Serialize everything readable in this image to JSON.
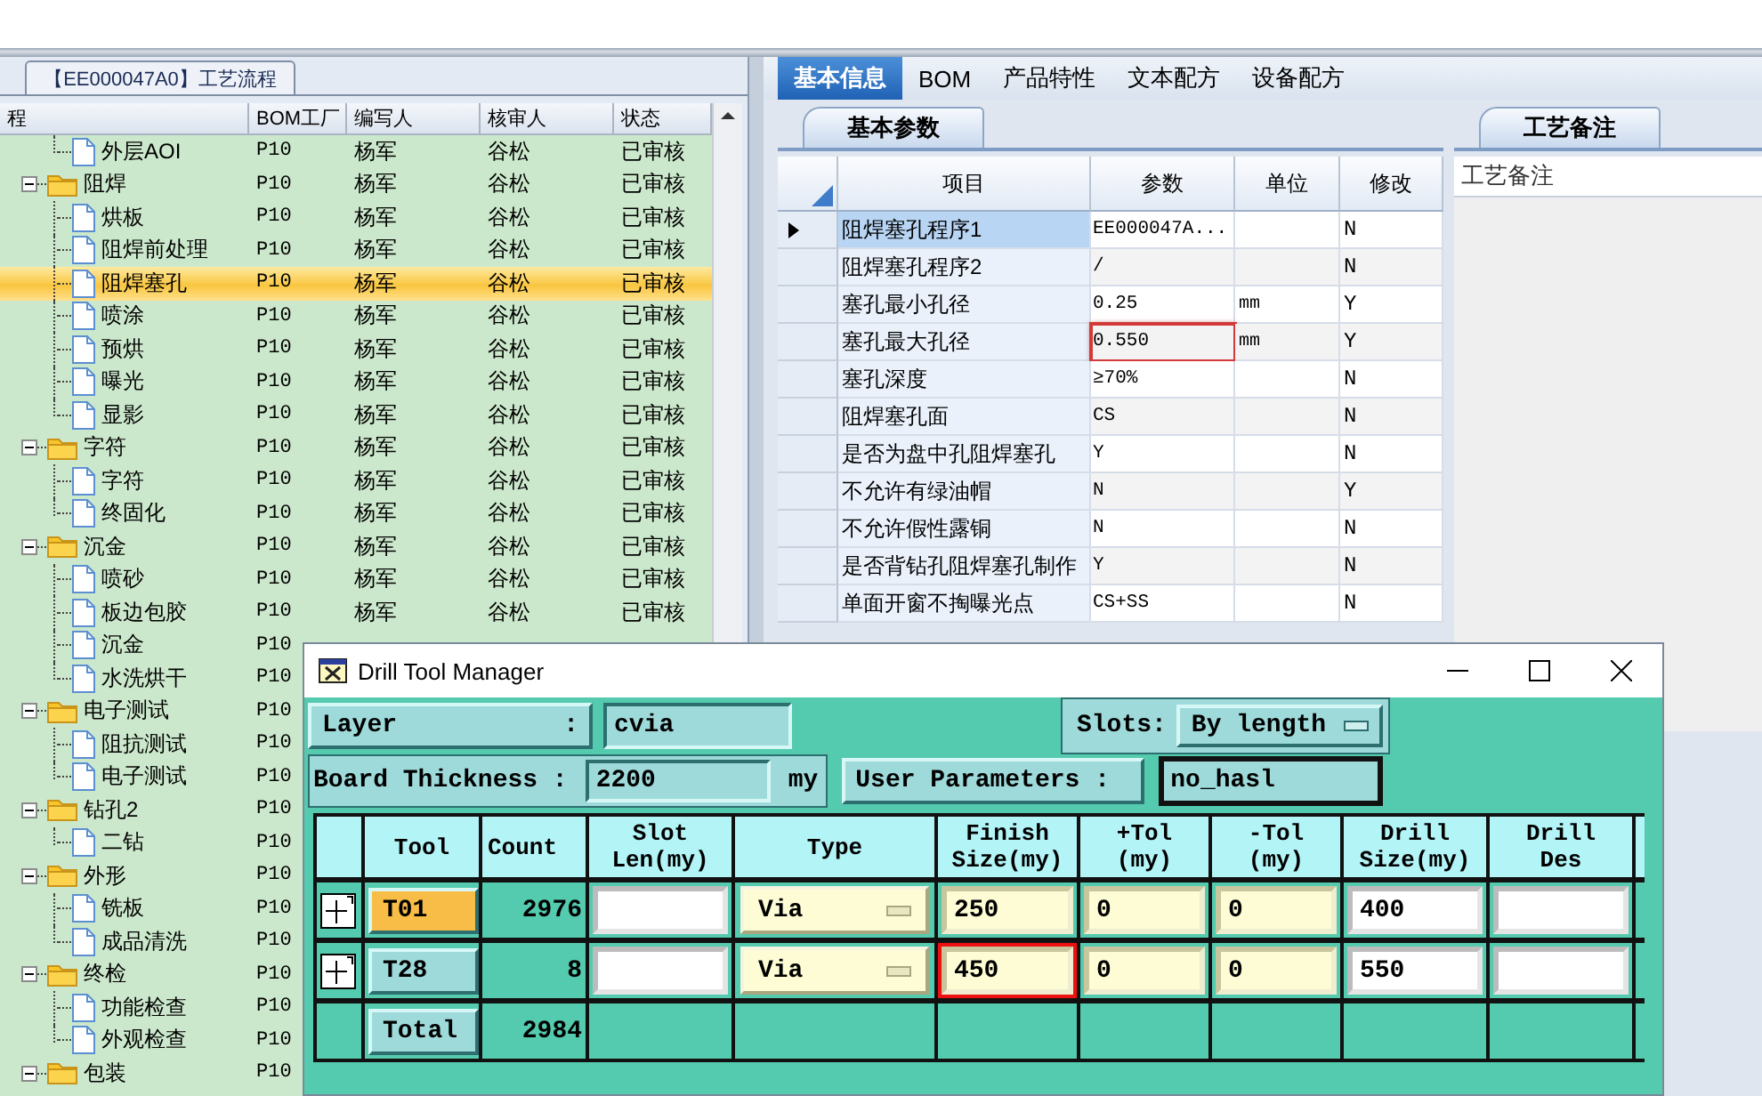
{
  "top_tab": {
    "label": "【EE000047A0】工艺流程"
  },
  "tree": {
    "columns": [
      "程",
      "BOM工厂",
      "编写人",
      "核审人",
      "状态"
    ],
    "items": [
      {
        "children": [
          {
            "name": "外层AOI",
            "bom": "P10",
            "writer": "杨军",
            "reviewer": "谷松",
            "status": "已审核",
            "selected": false
          }
        ]
      },
      {
        "name": "阻焊",
        "bom": "P10",
        "writer": "杨军",
        "reviewer": "谷松",
        "status": "已审核",
        "selected": false,
        "expanded": true,
        "children": [
          {
            "name": "烘板",
            "bom": "P10",
            "writer": "杨军",
            "reviewer": "谷松",
            "status": "已审核",
            "selected": false
          },
          {
            "name": "阻焊前处理",
            "bom": "P10",
            "writer": "杨军",
            "reviewer": "谷松",
            "status": "已审核",
            "selected": false
          },
          {
            "name": "阻焊塞孔",
            "bom": "P10",
            "writer": "杨军",
            "reviewer": "谷松",
            "status": "已审核",
            "selected": true
          },
          {
            "name": "喷涂",
            "bom": "P10",
            "writer": "杨军",
            "reviewer": "谷松",
            "status": "已审核",
            "selected": false
          },
          {
            "name": "预烘",
            "bom": "P10",
            "writer": "杨军",
            "reviewer": "谷松",
            "status": "已审核",
            "selected": false
          },
          {
            "name": "曝光",
            "bom": "P10",
            "writer": "杨军",
            "reviewer": "谷松",
            "status": "已审核",
            "selected": false
          },
          {
            "name": "显影",
            "bom": "P10",
            "writer": "杨军",
            "reviewer": "谷松",
            "status": "已审核",
            "selected": false
          }
        ]
      },
      {
        "name": "字符",
        "bom": "P10",
        "writer": "杨军",
        "reviewer": "谷松",
        "status": "已审核",
        "selected": false,
        "expanded": true,
        "children": [
          {
            "name": "字符",
            "bom": "P10",
            "writer": "杨军",
            "reviewer": "谷松",
            "status": "已审核",
            "selected": false
          },
          {
            "name": "终固化",
            "bom": "P10",
            "writer": "杨军",
            "reviewer": "谷松",
            "status": "已审核",
            "selected": false
          }
        ]
      },
      {
        "name": "沉金",
        "bom": "P10",
        "writer": "杨军",
        "reviewer": "谷松",
        "status": "已审核",
        "selected": false,
        "expanded": true,
        "children": [
          {
            "name": "喷砂",
            "bom": "P10",
            "writer": "杨军",
            "reviewer": "谷松",
            "status": "已审核",
            "selected": false
          },
          {
            "name": "板边包胶",
            "bom": "P10",
            "writer": "杨军",
            "reviewer": "谷松",
            "status": "已审核",
            "selected": false
          },
          {
            "name": "沉金",
            "bom": "P10",
            "selected": false
          },
          {
            "name": "水洗烘干",
            "bom": "P10",
            "selected": false
          }
        ]
      },
      {
        "name": "电子测试",
        "bom": "P10",
        "selected": false,
        "expanded": true,
        "children": [
          {
            "name": "阻抗测试",
            "bom": "P10",
            "selected": false
          },
          {
            "name": "电子测试",
            "bom": "P10",
            "selected": false
          }
        ]
      },
      {
        "name": "钻孔2",
        "bom": "P10",
        "selected": false,
        "expanded": true,
        "children": [
          {
            "name": "二钻",
            "bom": "P10",
            "selected": false
          }
        ]
      },
      {
        "name": "外形",
        "bom": "P10",
        "selected": false,
        "expanded": true,
        "children": [
          {
            "name": "铣板",
            "bom": "P10",
            "selected": false
          },
          {
            "name": "成品清洗",
            "bom": "P10",
            "selected": false
          }
        ]
      },
      {
        "name": "终检",
        "bom": "P10",
        "selected": false,
        "expanded": true,
        "children": [
          {
            "name": "功能检查",
            "bom": "P10",
            "selected": false
          },
          {
            "name": "外观检查",
            "bom": "P10",
            "selected": false
          }
        ]
      },
      {
        "name": "包装",
        "bom": "P10",
        "selected": false,
        "expanded": true
      }
    ]
  },
  "right_tabs": [
    {
      "label": "基本信息",
      "selected": true
    },
    {
      "label": "BOM",
      "selected": false
    },
    {
      "label": "产品特性",
      "selected": false
    },
    {
      "label": "文本配方",
      "selected": false
    },
    {
      "label": "设备配方",
      "selected": false
    }
  ],
  "params": {
    "tab": "基本参数",
    "columns": [
      "项目",
      "参数",
      "单位",
      "修改"
    ],
    "rows": [
      {
        "item": "阻焊塞孔程序1",
        "value": "EE000047A...",
        "modified": "N",
        "selected": true,
        "highlighted": false
      },
      {
        "item": "阻焊塞孔程序2",
        "value": "/",
        "modified": "N",
        "selected": false,
        "highlighted": false
      },
      {
        "item": "塞孔最小孔径",
        "value": "0.25",
        "unit": "mm",
        "modified": "Y",
        "selected": false,
        "highlighted": false
      },
      {
        "item": "塞孔最大孔径",
        "value": "0.550",
        "unit": "mm",
        "modified": "Y",
        "selected": false,
        "highlighted": true
      },
      {
        "item": "塞孔深度",
        "value": "≥70%",
        "modified": "N",
        "selected": false,
        "highlighted": false
      },
      {
        "item": "阻焊塞孔面",
        "value": "CS",
        "modified": "N",
        "selected": false,
        "highlighted": false
      },
      {
        "item": "是否为盘中孔阻焊塞孔",
        "value": "Y",
        "modified": "N",
        "selected": false,
        "highlighted": false
      },
      {
        "item": "不允许有绿油帽",
        "value": "N",
        "modified": "Y",
        "selected": false,
        "highlighted": false
      },
      {
        "item": "不允许假性露铜",
        "value": "N",
        "modified": "N",
        "selected": false,
        "highlighted": false
      },
      {
        "item": "是否背钻孔阻焊塞孔制作",
        "value": "Y",
        "modified": "N",
        "selected": false,
        "highlighted": false
      },
      {
        "item": "单面开窗不掏曝光点",
        "value": "CS+SS",
        "modified": "N",
        "selected": false,
        "highlighted": false
      }
    ]
  },
  "notes": {
    "tab": "工艺备注",
    "header": "工艺备注"
  },
  "dialog": {
    "title": "Drill Tool Manager",
    "layer": {
      "label": "Layer",
      "separator": ":",
      "value": "cvia"
    },
    "slots": {
      "label": "Slots:",
      "value": "By length"
    },
    "thickness": {
      "label": "Board Thickness :",
      "value": "2200",
      "unit": "my"
    },
    "user_params": {
      "label": "User Parameters :",
      "value": "no_hasl"
    },
    "columns": [
      "Tool",
      "Count",
      "Slot\nLen(my)",
      "Type",
      "Finish\nSize(my)",
      "+Tol\n(my)",
      "-Tol\n(my)",
      "Drill\nSize(my)",
      "Drill\nDes"
    ],
    "tools": [
      {
        "tool": "T01",
        "count": "2976",
        "type": "Via",
        "finish": "250",
        "plus_tol": "0",
        "minus_tol": "0",
        "drill": "400",
        "selected": true,
        "highlighted": false
      },
      {
        "tool": "T28",
        "count": "8",
        "type": "Via",
        "finish": "450",
        "plus_tol": "0",
        "minus_tol": "0",
        "drill": "550",
        "selected": false,
        "highlighted": true
      }
    ],
    "total": {
      "label": "Total",
      "count": "2984"
    }
  }
}
